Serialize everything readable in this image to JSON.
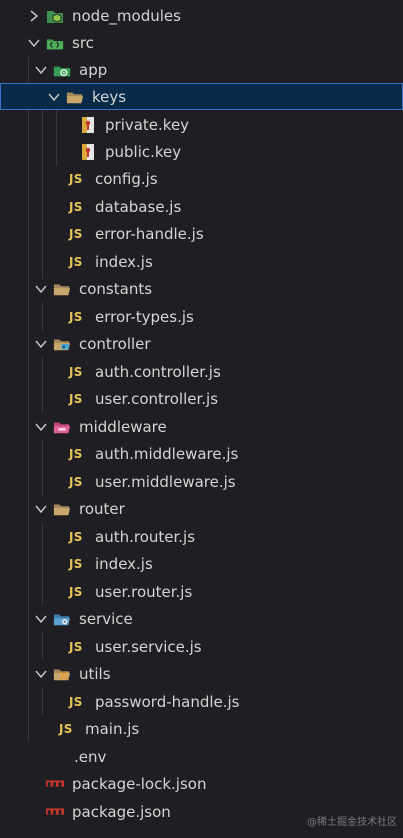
{
  "explorer": {
    "items": {
      "node_modules": "node_modules",
      "src": "src",
      "app": "app",
      "keys": "keys",
      "private_key": "private.key",
      "public_key": "public.key",
      "config": "config.js",
      "database": "database.js",
      "error_handle": "error-handle.js",
      "app_index": "index.js",
      "constants": "constants",
      "error_types": "error-types.js",
      "controller": "controller",
      "auth_controller": "auth.controller.js",
      "user_controller": "user.controller.js",
      "middleware": "middleware",
      "auth_middleware": "auth.middleware.js",
      "user_middleware": "user.middleware.js",
      "router": "router",
      "auth_router": "auth.router.js",
      "router_index": "index.js",
      "user_router": "user.router.js",
      "service": "service",
      "user_service": "user.service.js",
      "utils": "utils",
      "password_handle": "password-handle.js",
      "main": "main.js",
      "env": ".env",
      "package_lock": "package-lock.json",
      "package": "package.json"
    },
    "js_badge": "JS",
    "colors": {
      "background": "#1f1f23",
      "selected_bg": "#082b4a",
      "selected_border": "#3a73c9",
      "js_yellow": "#e5c45a",
      "folder_tan": "#c9a66b",
      "node_green": "#3f8f4e",
      "npm_red": "#c5352e"
    },
    "selected_item": "keys"
  },
  "watermark": "@稀土掘金技术社区"
}
